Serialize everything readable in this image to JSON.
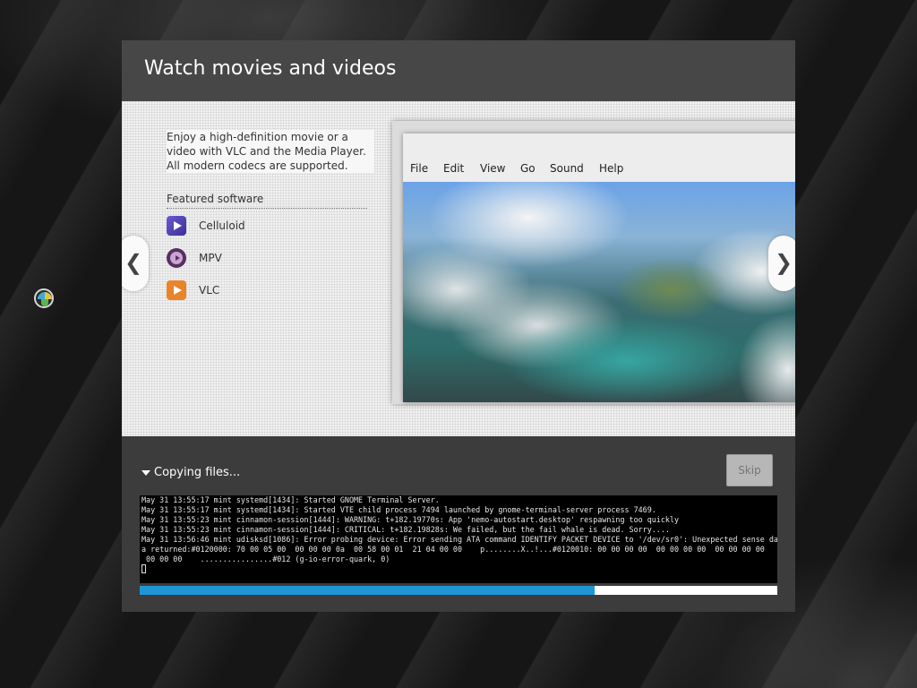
{
  "installer": {
    "title": "Watch movies and videos",
    "slide": {
      "description": "Enjoy a high-definition movie or a video with VLC and the Media Player. All modern codecs are supported.",
      "featured_heading": "Featured software",
      "apps": [
        {
          "label": "Celluloid",
          "icon": "celluloid-icon"
        },
        {
          "label": "MPV",
          "icon": "mpv-icon"
        },
        {
          "label": "VLC",
          "icon": "vlc-icon"
        }
      ],
      "prev_arrow": "❮",
      "next_arrow": "❯",
      "screenshot_menu": [
        "File",
        "Edit",
        "View",
        "Go",
        "Sound",
        "Help"
      ]
    },
    "status": {
      "label": "Copying files...",
      "skip_label": "Skip",
      "progress": 0.713
    },
    "terminal_lines": [
      "May 31 13:55:17 mint systemd[1434]: Started GNOME Terminal Server.",
      "May 31 13:55:17 mint systemd[1434]: Started VTE child process 7494 launched by gnome-terminal-server process 7469.",
      "May 31 13:55:23 mint cinnamon-session[1444]: WARNING: t+182.19770s: App 'nemo-autostart.desktop' respawning too quickly",
      "May 31 13:55:23 mint cinnamon-session[1444]: CRITICAL: t+182.19828s: We failed, but the fail whale is dead. Sorry....",
      "May 31 13:56:46 mint udisksd[1086]: Error probing device: Error sending ATA command IDENTIFY PACKET DEVICE to '/dev/sr0': Unexpected sense dat",
      "a returned:#0120000: 70 00 05 00  00 00 00 0a  00 58 00 01  21 04 00 00    p........X..!...#0120010: 00 00 00 00  00 00 00 00  00 00 00 00",
      " 00 00 00    ................#012 (g-io-error-quark, 0)"
    ]
  },
  "colors": {
    "progress_fill": "#1e96d5",
    "header_bg": "#474747",
    "panel_bg": "#3c3c3c"
  }
}
